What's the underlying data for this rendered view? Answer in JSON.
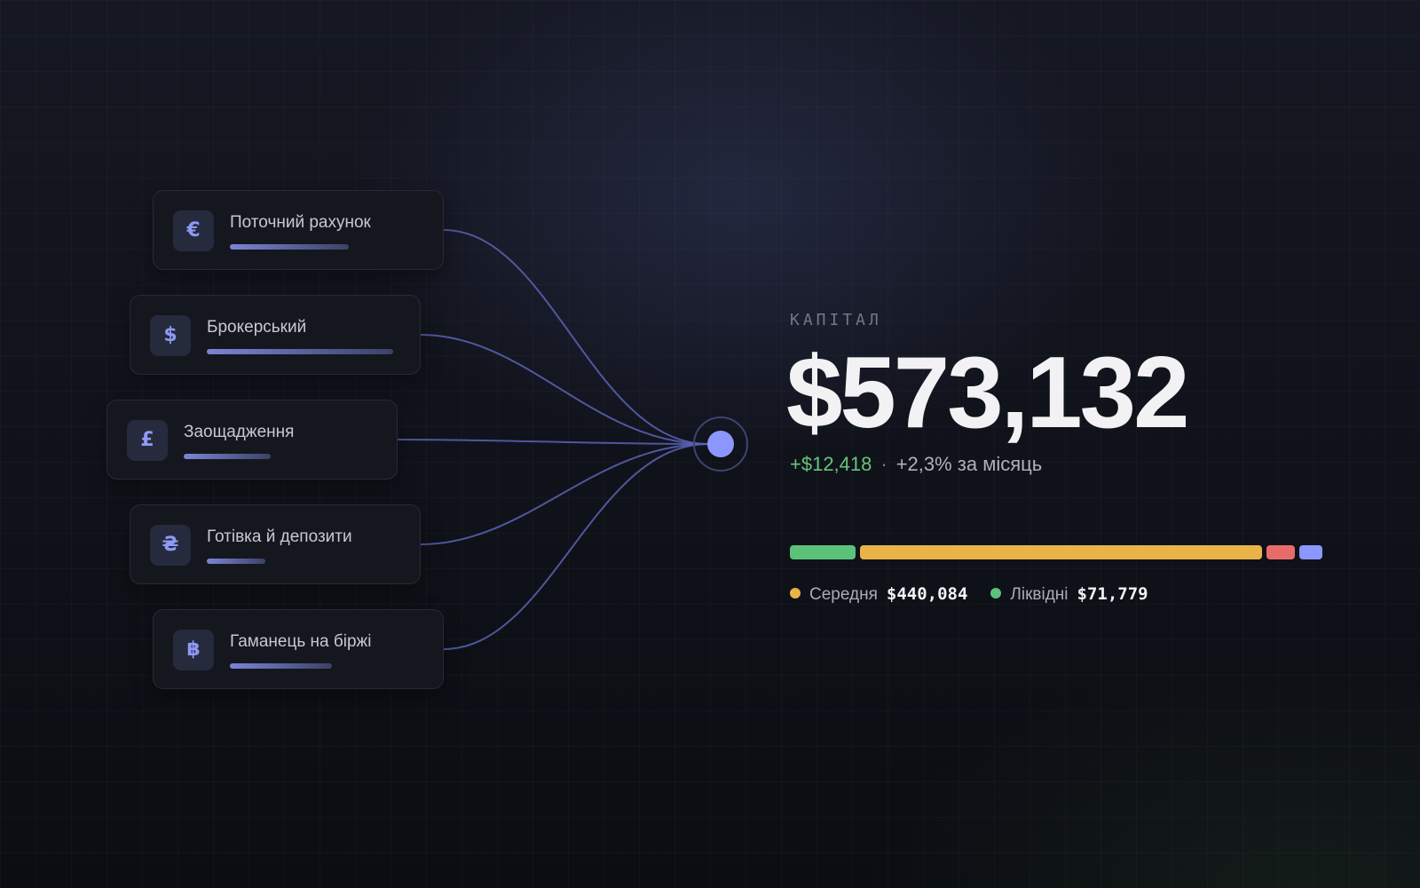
{
  "colors": {
    "accent": "#8b96ff",
    "link_line": "#5b63b5",
    "positive": "#66c47a",
    "medium": "#eab347",
    "risk": "#e86b6b",
    "other": "#8b96ff"
  },
  "accounts": [
    {
      "icon": "euro-icon",
      "symbol": "€",
      "label": "Поточний рахунок",
      "fill": 0.55
    },
    {
      "icon": "dollar-icon",
      "symbol": "$",
      "label": "Брокерський",
      "fill": 0.86
    },
    {
      "icon": "pound-icon",
      "symbol": "£",
      "label": "Заощадження",
      "fill": 0.4
    },
    {
      "icon": "hryvnia-icon",
      "symbol": "₴",
      "label": "Готівка й депозити",
      "fill": 0.27
    },
    {
      "icon": "bitcoin-icon",
      "symbol": "฿",
      "label": "Гаманець на біржі",
      "fill": 0.47
    }
  ],
  "summary": {
    "kicker": "КАПІТАЛ",
    "total": "$573,132",
    "change_abs": "+$12,418",
    "separator": "·",
    "change_pct": "+2,3% за місяць"
  },
  "allocation": {
    "segments": [
      {
        "name": "liquid",
        "value": 71779,
        "color": "#5cc27a"
      },
      {
        "name": "medium",
        "value": 440084,
        "color": "#eab347"
      },
      {
        "name": "risk",
        "value": 31000,
        "color": "#e86b6b"
      },
      {
        "name": "other",
        "value": 20000,
        "color": "#8b96ff"
      }
    ],
    "legend": [
      {
        "label": "Середня",
        "value": "$440,084",
        "color": "#eab347"
      },
      {
        "label": "Ліквідні",
        "value": "$71,779",
        "color": "#5cc27a"
      }
    ]
  }
}
